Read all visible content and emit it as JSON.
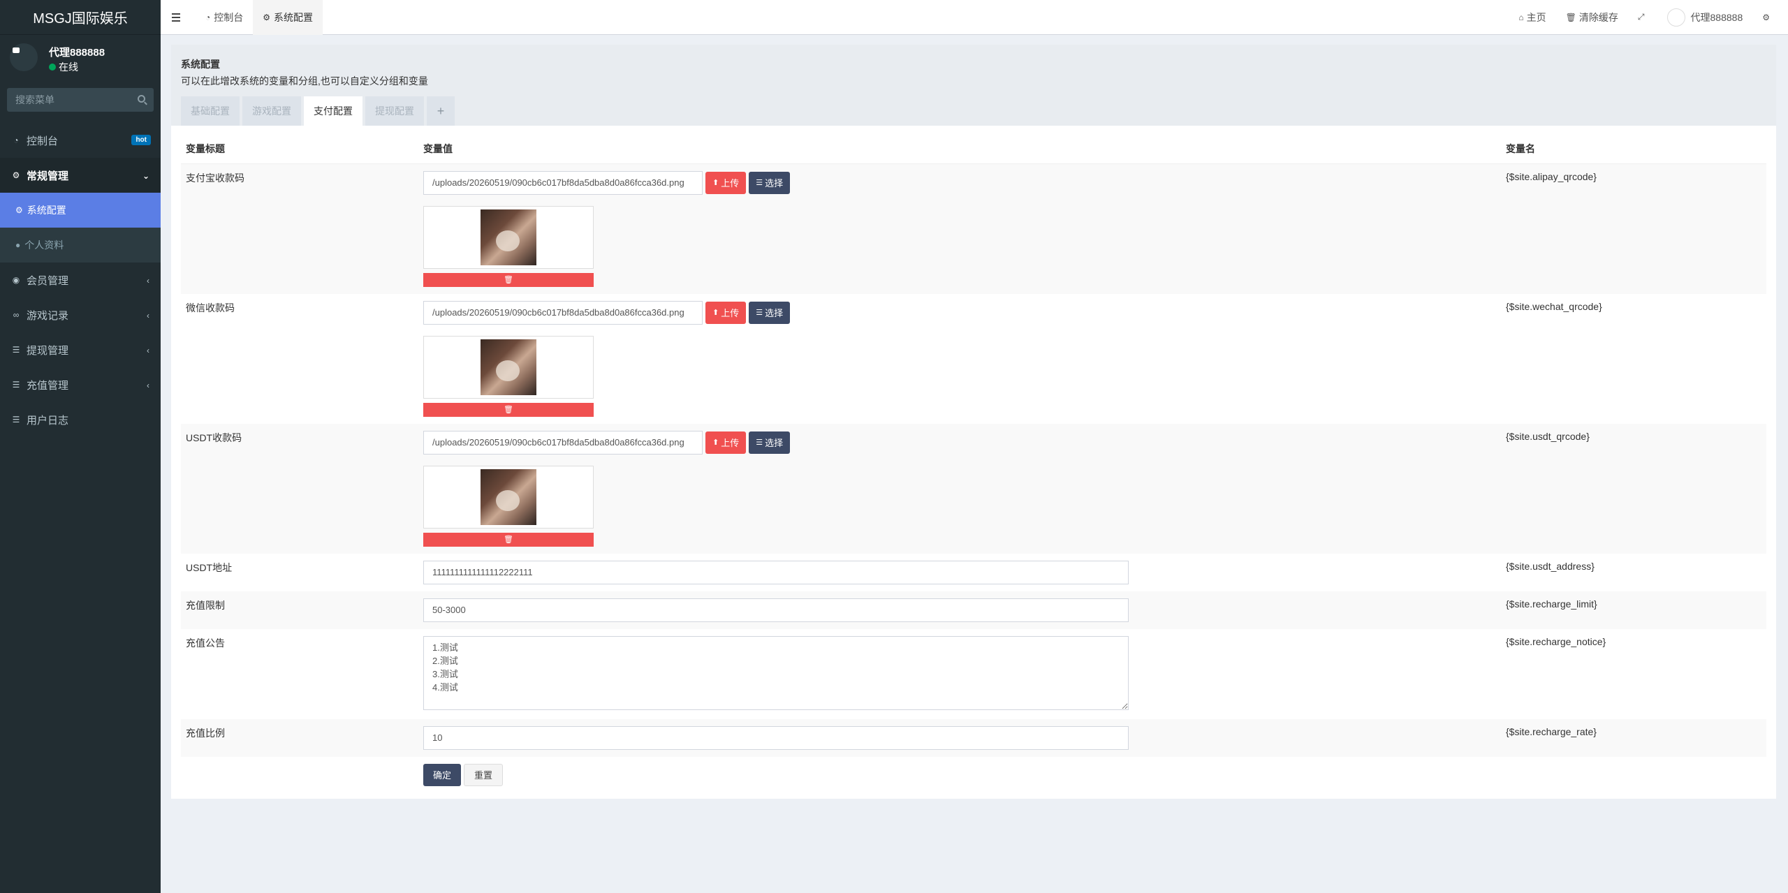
{
  "app": {
    "title": "MSGJ国际娱乐"
  },
  "user": {
    "name": "代理888888",
    "status": "在线"
  },
  "sidebar": {
    "search_placeholder": "搜索菜单",
    "items": [
      {
        "label": "控制台",
        "badge": "hot"
      },
      {
        "label": "常规管理"
      },
      {
        "label": "系统配置"
      },
      {
        "label": "个人资料"
      },
      {
        "label": "会员管理"
      },
      {
        "label": "游戏记录"
      },
      {
        "label": "提现管理"
      },
      {
        "label": "充值管理"
      },
      {
        "label": "用户日志"
      }
    ]
  },
  "header": {
    "tabs": [
      {
        "label": "控制台"
      },
      {
        "label": "系统配置"
      }
    ],
    "home": "主页",
    "clear_cache": "清除缓存",
    "username": "代理888888"
  },
  "page": {
    "title": "系统配置",
    "subtitle": "可以在此增改系统的变量和分组,也可以自定义分组和变量",
    "tabs": [
      "基础配置",
      "游戏配置",
      "支付配置",
      "提现配置",
      "+"
    ],
    "columns": [
      "变量标题",
      "变量值",
      "变量名"
    ],
    "upload_label": "上传",
    "choose_label": "选择",
    "rows": {
      "alipay": {
        "title": "支付宝收款码",
        "value": "/uploads/20260519/090cb6c017bf8da5dba8d0a86fcca36d.png",
        "name": "{$site.alipay_qrcode}"
      },
      "wechat": {
        "title": "微信收款码",
        "value": "/uploads/20260519/090cb6c017bf8da5dba8d0a86fcca36d.png",
        "name": "{$site.wechat_qrcode}"
      },
      "usdt_qr": {
        "title": "USDT收款码",
        "value": "/uploads/20260519/090cb6c017bf8da5dba8d0a86fcca36d.png",
        "name": "{$site.usdt_qrcode}"
      },
      "usdt_addr": {
        "title": "USDT地址",
        "value": "1111111111111112222111",
        "name": "{$site.usdt_address}"
      },
      "limit": {
        "title": "充值限制",
        "value": "50-3000",
        "name": "{$site.recharge_limit}"
      },
      "notice": {
        "title": "充值公告",
        "value": "1.测试\n2.测试\n3.测试\n4.测试",
        "name": "{$site.recharge_notice}"
      },
      "rate": {
        "title": "充值比例",
        "value": "10",
        "name": "{$site.recharge_rate}"
      }
    },
    "submit": "确定",
    "reset": "重置"
  }
}
